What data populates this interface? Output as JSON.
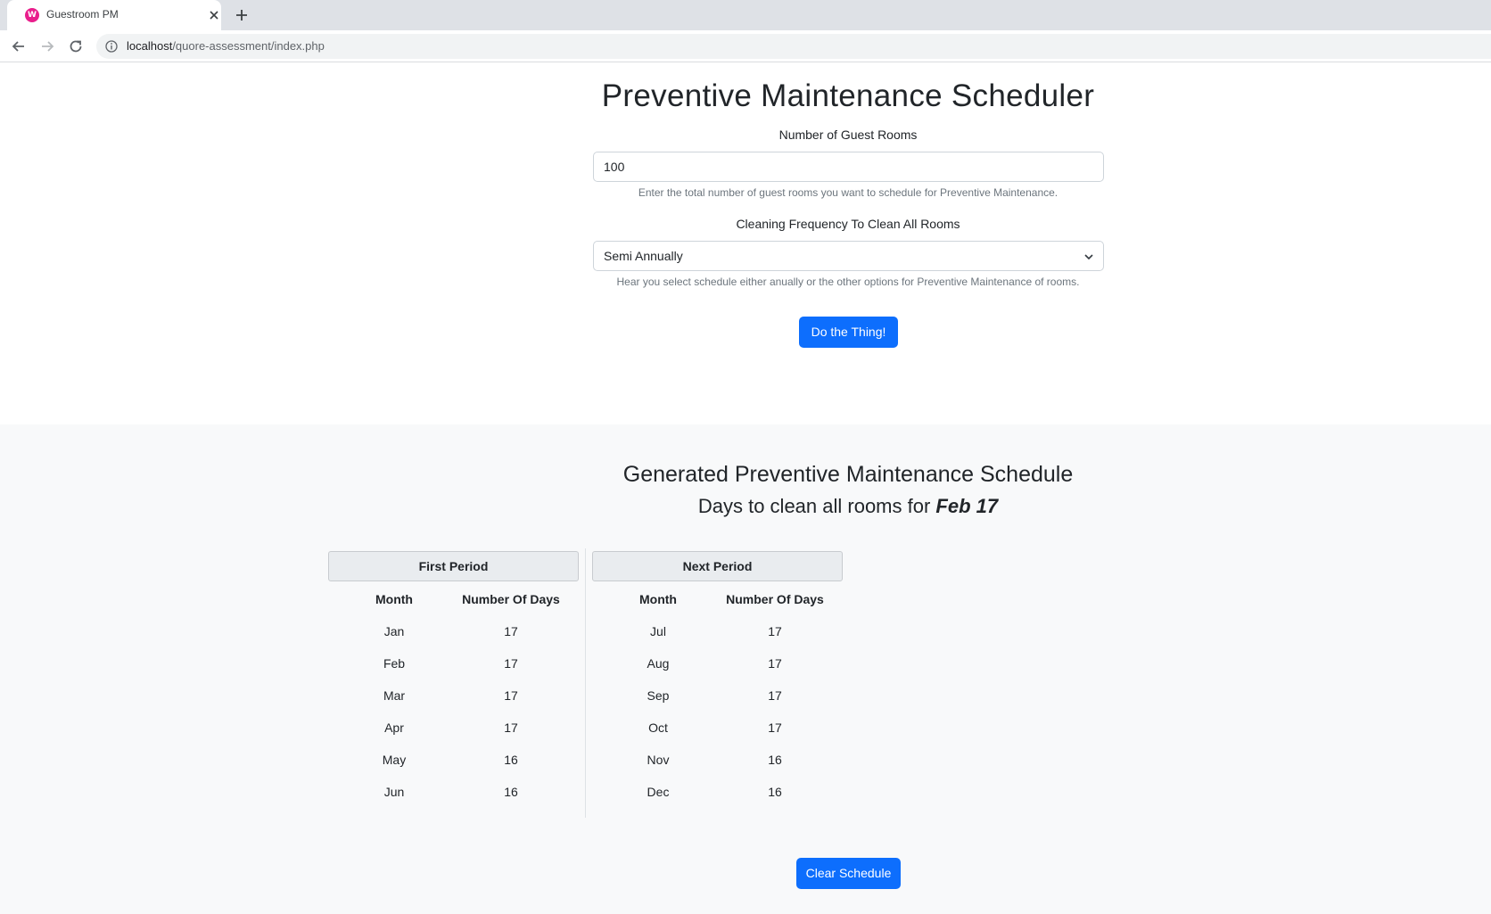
{
  "browser": {
    "tab_title": "Guestroom PM",
    "favicon_letter": "W",
    "url_host": "localhost",
    "url_path": "/quore-assessment/index.php"
  },
  "page": {
    "title": "Preventive Maintenance Scheduler",
    "rooms_label": "Number of Guest Rooms",
    "rooms_value": "100",
    "rooms_help": "Enter the total number of guest rooms you want to schedule for Preventive Maintenance.",
    "frequency_label": "Cleaning Frequency To Clean All Rooms",
    "frequency_value": "Semi Annually",
    "frequency_help": "Hear you select schedule either anually or the other options for Preventive Maintenance of rooms.",
    "submit_label": "Do the Thing!"
  },
  "results": {
    "title": "Generated Preventive Maintenance Schedule",
    "subtitle_prefix": "Days to clean all rooms for",
    "subtitle_date": "Feb 17",
    "clear_label": "Clear Schedule",
    "periods": [
      {
        "name": "First Period",
        "col_month": "Month",
        "col_days": "Number Of Days",
        "rows": [
          {
            "month": "Jan",
            "days": "17"
          },
          {
            "month": "Feb",
            "days": "17"
          },
          {
            "month": "Mar",
            "days": "17"
          },
          {
            "month": "Apr",
            "days": "17"
          },
          {
            "month": "May",
            "days": "16"
          },
          {
            "month": "Jun",
            "days": "16"
          }
        ]
      },
      {
        "name": "Next Period",
        "col_month": "Month",
        "col_days": "Number Of Days",
        "rows": [
          {
            "month": "Jul",
            "days": "17"
          },
          {
            "month": "Aug",
            "days": "17"
          },
          {
            "month": "Sep",
            "days": "17"
          },
          {
            "month": "Oct",
            "days": "17"
          },
          {
            "month": "Nov",
            "days": "16"
          },
          {
            "month": "Dec",
            "days": "16"
          }
        ]
      }
    ]
  },
  "colors": {
    "primary": "#0d6efd",
    "results_bg": "#f8f9fa",
    "period_header_bg": "#e9ecef"
  }
}
